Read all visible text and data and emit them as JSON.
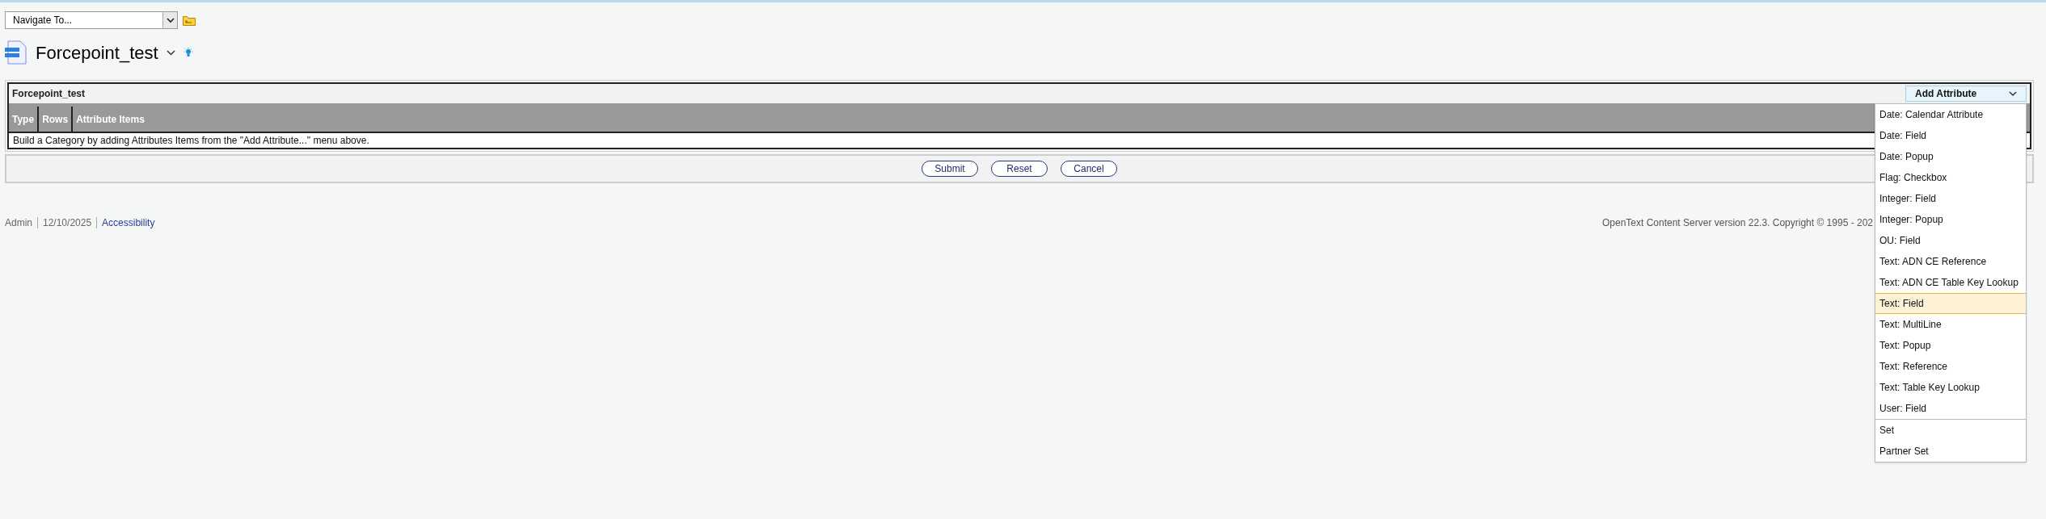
{
  "navigate": {
    "value": "Navigate To..."
  },
  "title": "Forcepoint_test",
  "panel": {
    "title": "Forcepoint_test",
    "add_attribute": {
      "label": "Add Attribute",
      "expanded": true
    },
    "columns": [
      "Type",
      "Rows",
      "Attribute Items"
    ],
    "message": "Build a Category by adding Attributes Items from the \"Add Attribute...\" menu above."
  },
  "buttons": [
    "Submit",
    "Reset",
    "Cancel"
  ],
  "footer": {
    "links": [
      {
        "label": "Admin",
        "kind": "text"
      },
      {
        "label": "12/10/2025",
        "kind": "text"
      },
      {
        "label": "Accessibility",
        "kind": "link"
      }
    ],
    "copyright": "OpenText Content Server version 22.3. Copyright © 1995 - 202"
  },
  "menu": {
    "groups": [
      [
        {
          "label": "Date: Calendar Attribute",
          "selected": false
        },
        {
          "label": "Date: Field",
          "selected": false
        },
        {
          "label": "Date: Popup",
          "selected": false
        },
        {
          "label": "Flag: Checkbox",
          "selected": false
        },
        {
          "label": "Integer: Field",
          "selected": false
        },
        {
          "label": "Integer: Popup",
          "selected": false
        },
        {
          "label": "OU: Field",
          "selected": false
        },
        {
          "label": "Text: ADN CE Reference",
          "selected": false
        },
        {
          "label": "Text: ADN CE Table Key Lookup",
          "selected": false
        },
        {
          "label": "Text: Field",
          "selected": true
        },
        {
          "label": "Text: MultiLine",
          "selected": false
        },
        {
          "label": "Text: Popup",
          "selected": false
        },
        {
          "label": "Text: Reference",
          "selected": false
        },
        {
          "label": "Text: Table Key Lookup",
          "selected": false
        },
        {
          "label": "User: Field",
          "selected": false
        }
      ],
      [
        {
          "label": "Set",
          "selected": false
        },
        {
          "label": "Partner Set",
          "selected": false
        }
      ]
    ]
  }
}
